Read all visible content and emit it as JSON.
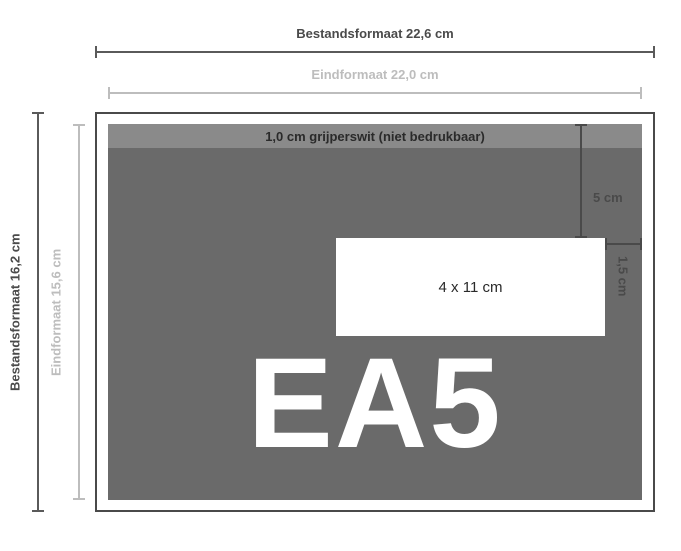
{
  "outer_top_label": "Bestandsformaat 22,6 cm",
  "inner_top_label": "Eindformaat 22,0 cm",
  "outer_left_label": "Bestandsformaat 16,2 cm",
  "inner_left_label": "Eindformaat 15,6 cm",
  "gripper_text": "1,0 cm grijperswit (niet bedrukbaar)",
  "right_5cm_label": "5 cm",
  "right_15cm_label": "1,5 cm",
  "window_text": "4 x 11 cm",
  "big_label": "EA5",
  "chart_data": {
    "type": "diagram",
    "envelope_format": "EA5",
    "file_format_cm": {
      "width": 22.6,
      "height": 16.2
    },
    "final_format_cm": {
      "width": 22.0,
      "height": 15.6
    },
    "gripper_white_cm": 1.0,
    "window_size_cm": {
      "width": 11,
      "height": 4
    },
    "window_offset_from_top_cm": 5,
    "window_offset_from_right_cm": 1.5
  }
}
